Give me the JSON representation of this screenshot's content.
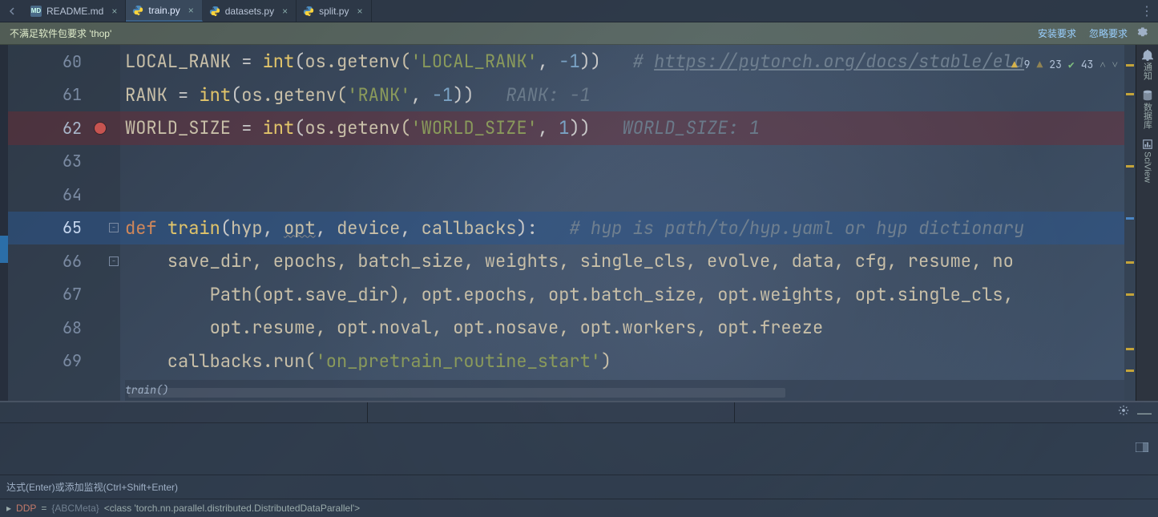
{
  "tabs": [
    {
      "label": "README.md",
      "kind": "md",
      "active": false
    },
    {
      "label": "train.py",
      "kind": "py",
      "active": true
    },
    {
      "label": "datasets.py",
      "kind": "py",
      "active": false
    },
    {
      "label": "split.py",
      "kind": "py",
      "active": false
    }
  ],
  "req": {
    "msg": "不满足软件包要求 'thop'",
    "install": "安装要求",
    "ignore": "忽略要求"
  },
  "lint": {
    "warn": "9",
    "weakwarn": "23",
    "ok": "43"
  },
  "lines": {
    "l60": "60",
    "l61": "61",
    "l62": "62",
    "l63": "63",
    "l64": "64",
    "l65": "65",
    "l66": "66",
    "l67": "67",
    "l68": "68",
    "l69": "69"
  },
  "code": {
    "l60": {
      "pre": "LOCAL_RANK ",
      "eq": "= ",
      "int": "int",
      "lp": "(",
      "os": "os.getenv(",
      "s": "'LOCAL_RANK'",
      "c": ", ",
      "n": "-1",
      "rp": "))",
      "sp": "   ",
      "hash": "# ",
      "url": "https://pytorch.org/docs/stable/ela"
    },
    "l61": {
      "pre": "RANK ",
      "eq": "= ",
      "int": "int",
      "lp": "(",
      "os": "os.getenv(",
      "s": "'RANK'",
      "c": ", ",
      "n": "-1",
      "rp": "))",
      "sp": "   ",
      "cm": "RANK: -1"
    },
    "l62": {
      "pre": "WORLD_SIZE ",
      "eq": "= ",
      "int": "int",
      "lp": "(",
      "os": "os.getenv(",
      "s": "'WORLD_SIZE'",
      "c": ", ",
      "n": "1",
      "rp": "))",
      "sp": "   ",
      "cm": "WORLD_SIZE: 1"
    },
    "l65": {
      "def": "def ",
      "fn": "train",
      "lp": "(",
      "a1": "hyp",
      "c1": ", ",
      "a2": "opt",
      "c2": ", ",
      "a3": "device",
      "c3": ", ",
      "a4": "callbacks",
      "rp": "):",
      "sp": "   ",
      "cm": "# hyp is path/to/hyp.yaml or hyp dictionary"
    },
    "l66": "    save_dir, epochs, batch_size, weights, single_cls, evolve, data, cfg, resume, no",
    "l67": "        Path(opt.save_dir), opt.epochs, opt.batch_size, opt.weights, opt.single_cls,",
    "l68": "        opt.resume, opt.noval, opt.nosave, opt.workers, opt.freeze",
    "l69": {
      "a": "    callbacks.run(",
      "s": "'on_pretrain_routine_start'",
      "b": ")"
    }
  },
  "crumb": "train()",
  "watches_hint": "达式(Enter)或添加监视(Ctrl+Shift+Enter)",
  "dbg": {
    "var": "DDP",
    "eq": " = ",
    "type": "{ABCMeta} ",
    "val": "<class 'torch.nn.parallel.distributed.DistributedDataParallel'>"
  },
  "right": {
    "notif": "通知",
    "db": "数据库",
    "sci": "SciView"
  }
}
